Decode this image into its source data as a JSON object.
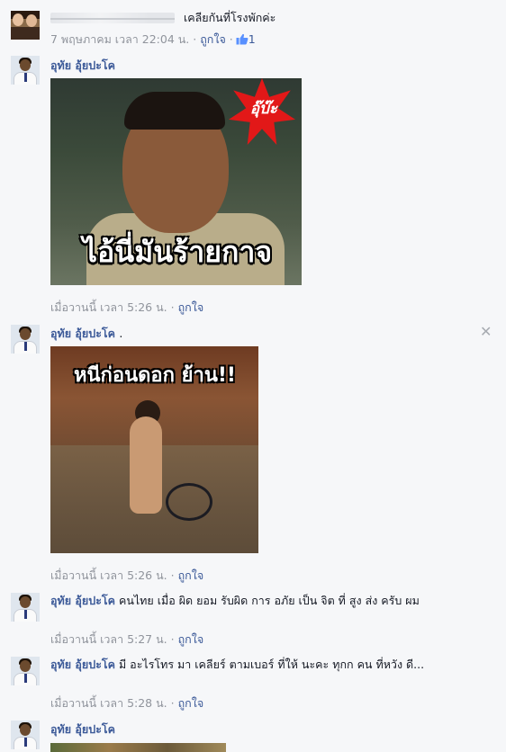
{
  "comments": [
    {
      "author": "",
      "text": "เคลียกันที่โรงพักค่ะ",
      "meta": {
        "time": "7 พฤษภาคม เวลา 22:04 น.",
        "like_label": "ถูกใจ",
        "like_count": "1",
        "sep": "·"
      }
    },
    {
      "author": "อุทัย อุ้ยปะโค",
      "sticker": {
        "burst_text": "อุ๊บ๊ะ",
        "caption": "ไอ้นี่มันร้ายกาจ"
      },
      "meta": {
        "time": "เมื่อวานนี้ เวลา 5:26 น.",
        "like_label": "ถูกใจ",
        "sep": "·"
      }
    },
    {
      "author": "อุทัย อุ้ยปะโค",
      "text": ".",
      "sticker": {
        "caption": "หนีก่อนดอก ย้าน!!"
      },
      "meta": {
        "time": "เมื่อวานนี้ เวลา 5:26 น.",
        "like_label": "ถูกใจ",
        "sep": "·"
      }
    },
    {
      "author": "อุทัย อุ้ยปะโค",
      "text": "คนไทย เมื่อ ผิด ยอม รับผิด การ อภัย เป็น จิต ที่ สูง ส่ง ครับ ผม",
      "meta": {
        "time": "เมื่อวานนี้ เวลา 5:27 น.",
        "like_label": "ถูกใจ",
        "sep": "·"
      }
    },
    {
      "author": "อุทัย อุ้ยปะโค",
      "text": "มี อะไรโทร มา เคลียร์ ตามเบอร์ ที่ให้ นะคะ ทุกก คน ที่หวัง ดี...",
      "meta": {
        "time": "เมื่อวานนี้ เวลา 5:28 น.",
        "like_label": "ถูกใจ",
        "sep": "·"
      }
    },
    {
      "author": "อุทัย อุ้ยปะโค"
    }
  ],
  "icons": {
    "like": "thumbs-up-icon",
    "close": "close-icon"
  },
  "colors": {
    "link": "#3b5998",
    "meta": "#90949c",
    "background": "#f6f7f9"
  }
}
